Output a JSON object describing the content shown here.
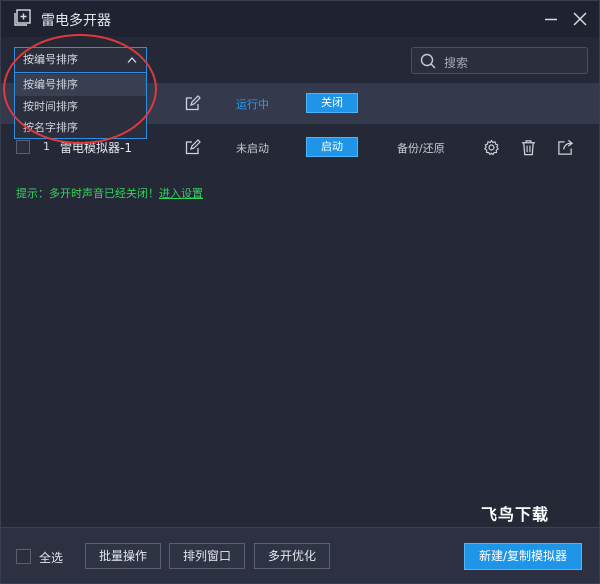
{
  "window": {
    "title": "雷电多开器"
  },
  "toolbar": {
    "sort_selected": "按编号排序",
    "search_placeholder": "搜索"
  },
  "sort_dropdown": {
    "options": [
      "按编号排序",
      "按时间排序",
      "按名字排序"
    ]
  },
  "emulators": [
    {
      "index": "",
      "name": "",
      "status": "运行中",
      "action": "关闭"
    },
    {
      "index": "1",
      "name": "雷电模拟器-1",
      "status": "未启动",
      "action": "启动",
      "backup": "备份/还原"
    }
  ],
  "hint": {
    "text": "提示：多开时声音已经关闭！",
    "link": "进入设置"
  },
  "watermark": "飞鸟下载",
  "bottom": {
    "select_all": "全选",
    "batch": "批量操作",
    "arrange": "排列窗口",
    "optimize": "多开优化",
    "create": "新建/复制模拟器"
  },
  "colors": {
    "accent": "#1f95e8",
    "running": "#2e9bf0",
    "hint": "#33d35c",
    "annotation": "#e0393b"
  }
}
